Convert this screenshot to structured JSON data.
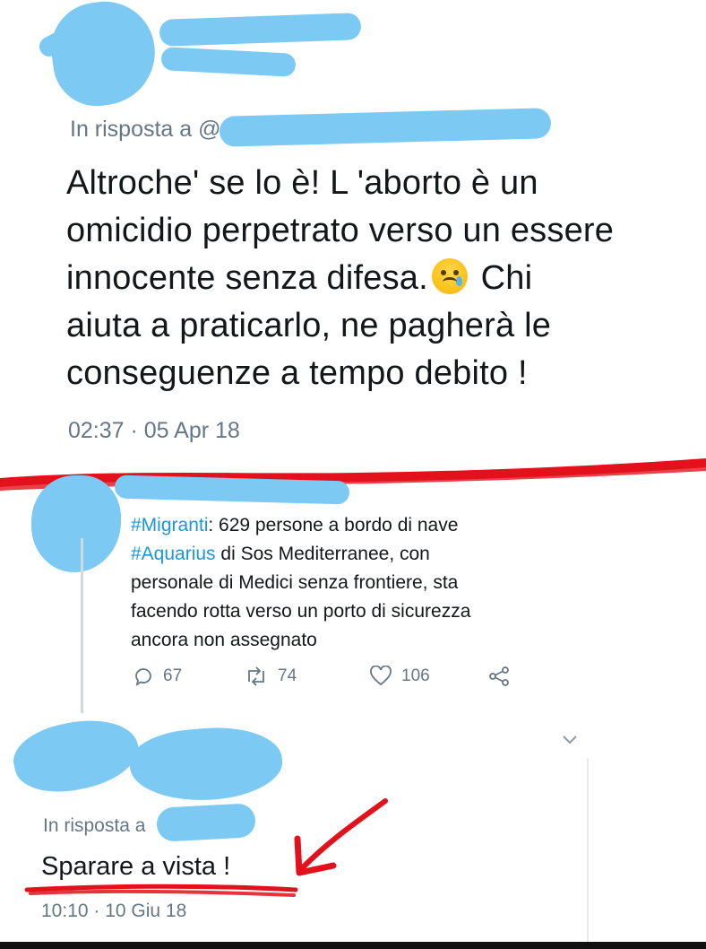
{
  "top_tweet": {
    "reply_prefix": "In risposta a",
    "text": "Altroche' se lo è!  L 'aborto è  un\nomicidio perpetrato verso un essere\ninnocente  senza difesa.",
    "text_tail": " Chi\naiuta a praticarlo, ne pagherà le\nconseguenze  a tempo debito !",
    "timestamp": "02:37 · 05 Apr 18"
  },
  "quoted_tweet": {
    "hashtag_1": "#Migranti",
    "text_1": ": 629 persone  a bordo di nave\n",
    "hashtag_2": "#Aquarius",
    "text_2": " di Sos Mediterranee, con\npersonale di Medici senza  frontiere,  sta\nfacendo rotta verso un porto di sicurezza\nancora non assegnato",
    "replies": "67",
    "retweets": "74",
    "likes": "106"
  },
  "bottom_tweet": {
    "reply_prefix": "In risposta a",
    "text": "Sparare a vista !",
    "timestamp": "10:10 · 10 Giu 18"
  },
  "colors": {
    "redaction": "#7ccaf4",
    "annotation_red": "#e2111b",
    "secondary_text": "#657786",
    "hashtag": "#1b95e0"
  }
}
